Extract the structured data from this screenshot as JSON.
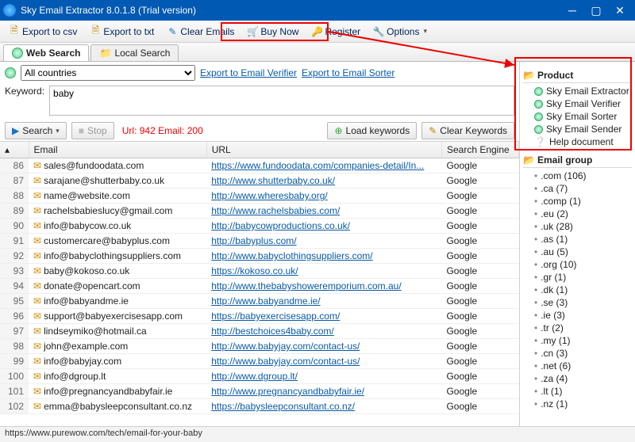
{
  "title": "Sky Email Extractor 8.0.1.8 (Trial version)",
  "toolbar": {
    "export_csv": "Export to csv",
    "export_txt": "Export to txt",
    "clear_emails": "Clear Emails",
    "buy_now": "Buy Now",
    "register": "Register",
    "options": "Options"
  },
  "tabs": {
    "web_search": "Web Search",
    "local_search": "Local Search"
  },
  "countries_selected": "All countries",
  "export_verifier": "Export to Email Verifier",
  "export_sorter": "Export to Email Sorter",
  "keyword_label": "Keyword:",
  "keyword_value": "baby",
  "search_btn": "Search",
  "stop_btn": "Stop",
  "counts_text": "Url: 942 Email: 200",
  "load_keywords": "Load keywords",
  "clear_keywords": "Clear Keywords",
  "col_email": "Email",
  "col_url": "URL",
  "col_engine": "Search Engine",
  "rows": [
    {
      "n": 86,
      "email": "sales@fundoodata.com",
      "url": "https://www.fundoodata.com/companies-detail/In...",
      "engine": "Google"
    },
    {
      "n": 87,
      "email": "sarajane@shutterbaby.co.uk",
      "url": "http://www.shutterbaby.co.uk/",
      "engine": "Google"
    },
    {
      "n": 88,
      "email": "name@website.com",
      "url": "http://www.wheresbaby.org/",
      "engine": "Google"
    },
    {
      "n": 89,
      "email": "rachelsbabieslucy@gmail.com",
      "url": "http://www.rachelsbabies.com/",
      "engine": "Google"
    },
    {
      "n": 90,
      "email": "info@babycow.co.uk",
      "url": "http://babycowproductions.co.uk/",
      "engine": "Google"
    },
    {
      "n": 91,
      "email": "customercare@babyplus.com",
      "url": "http://babyplus.com/",
      "engine": "Google"
    },
    {
      "n": 92,
      "email": "info@babyclothingsuppliers.com",
      "url": "http://www.babyclothingsuppliers.com/",
      "engine": "Google"
    },
    {
      "n": 93,
      "email": "baby@kokoso.co.uk",
      "url": "https://kokoso.co.uk/",
      "engine": "Google"
    },
    {
      "n": 94,
      "email": "donate@opencart.com",
      "url": "http://www.thebabyshoweremporium.com.au/",
      "engine": "Google"
    },
    {
      "n": 95,
      "email": "info@babyandme.ie",
      "url": "http://www.babyandme.ie/",
      "engine": "Google"
    },
    {
      "n": 96,
      "email": "support@babyexercisesapp.com",
      "url": "https://babyexercisesapp.com/",
      "engine": "Google"
    },
    {
      "n": 97,
      "email": "lindseymiko@hotmail.ca",
      "url": "http://bestchoices4baby.com/",
      "engine": "Google"
    },
    {
      "n": 98,
      "email": "john@example.com",
      "url": "http://www.babyjay.com/contact-us/",
      "engine": "Google"
    },
    {
      "n": 99,
      "email": "info@babyjay.com",
      "url": "http://www.babyjay.com/contact-us/",
      "engine": "Google"
    },
    {
      "n": 100,
      "email": "info@dgroup.lt",
      "url": "http://www.dgroup.lt/",
      "engine": "Google"
    },
    {
      "n": 101,
      "email": "info@pregnancyandbabyfair.ie",
      "url": "http://www.pregnancyandbabyfair.ie/",
      "engine": "Google"
    },
    {
      "n": 102,
      "email": "emma@babysleepconsultant.co.nz",
      "url": "https://babysleepconsultant.co.nz/",
      "engine": "Google"
    }
  ],
  "product_header": "Product",
  "products": [
    "Sky Email Extractor",
    "Sky Email Verifier",
    "Sky Email Sorter",
    "Sky Email Sender",
    "Help document"
  ],
  "email_group_header": "Email group",
  "groups": [
    {
      "ext": ".com",
      "n": 106
    },
    {
      "ext": ".ca",
      "n": 7
    },
    {
      "ext": ".comp",
      "n": 1
    },
    {
      "ext": ".eu",
      "n": 2
    },
    {
      "ext": ".uk",
      "n": 28
    },
    {
      "ext": ".as",
      "n": 1
    },
    {
      "ext": ".au",
      "n": 5
    },
    {
      "ext": ".org",
      "n": 10
    },
    {
      "ext": ".gr",
      "n": 1
    },
    {
      "ext": ".dk",
      "n": 1
    },
    {
      "ext": ".se",
      "n": 3
    },
    {
      "ext": ".ie",
      "n": 3
    },
    {
      "ext": ".tr",
      "n": 2
    },
    {
      "ext": ".my",
      "n": 1
    },
    {
      "ext": ".cn",
      "n": 3
    },
    {
      "ext": ".net",
      "n": 6
    },
    {
      "ext": ".za",
      "n": 4
    },
    {
      "ext": ".lt",
      "n": 1
    },
    {
      "ext": ".nz",
      "n": 1
    }
  ],
  "status": "https://www.purewow.com/tech/email-for-your-baby"
}
